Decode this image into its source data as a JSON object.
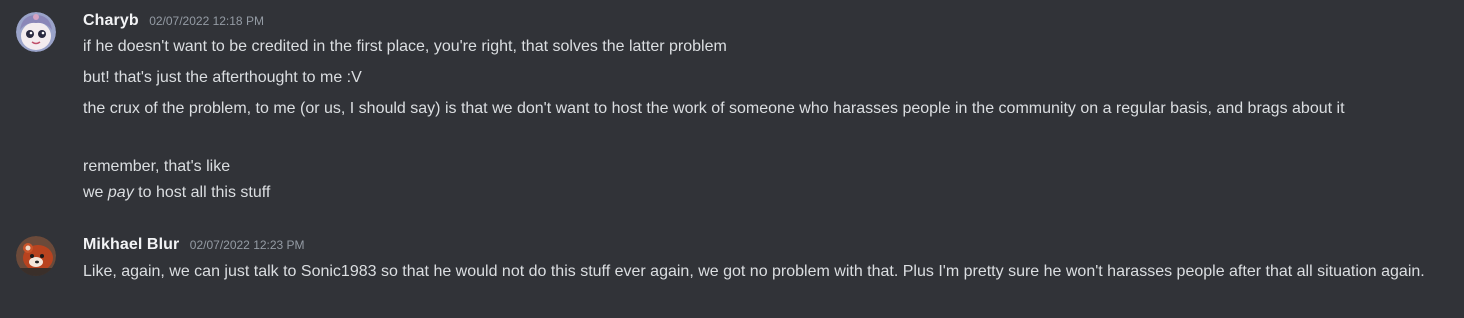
{
  "messages": [
    {
      "author": "Charyb",
      "timestamp": "02/07/2022 12:18 PM",
      "avatar_icon": "anime-avatar-icon",
      "lines": [
        "if he doesn't want to be credited in the first place, you're right, that solves the latter problem",
        "but! that's just the afterthought to me :V",
        "the crux of the problem, to me (or us, I should say) is that we don't want to host the work of someone who harasses people in the community on a regular basis, and brags about it",
        "remember, that's like"
      ],
      "italic_line": {
        "before": "we ",
        "emphasis": "pay",
        "after": " to host all this stuff"
      }
    },
    {
      "author": "Mikhael Blur",
      "timestamp": "02/07/2022 12:23 PM",
      "avatar_icon": "red-panda-avatar-icon",
      "lines": [
        "Like, again, we can just talk to Sonic1983 so that he would not do this stuff ever again, we got no problem with that. Plus I'm pretty sure he won't harasses people after that all situation again."
      ]
    }
  ],
  "colors": {
    "background": "#313338",
    "text": "#dbdee1",
    "username": "#f2f3f5",
    "timestamp": "#949ba4"
  }
}
